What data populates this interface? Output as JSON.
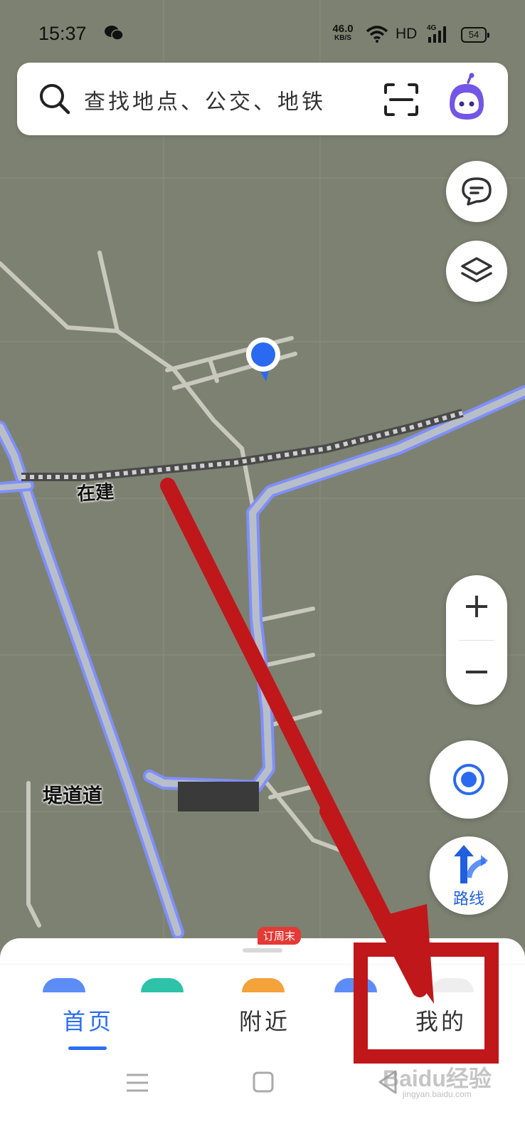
{
  "status_bar": {
    "time": "15:37",
    "speed_value": "46.0",
    "speed_unit": "KB/S",
    "hd": "HD",
    "network": "4G",
    "battery": "54",
    "icons": [
      "wechat-icon",
      "wifi-icon",
      "signal-icon",
      "battery-icon"
    ]
  },
  "search": {
    "placeholder": "查找地点、公交、地铁",
    "icons": [
      "search-icon",
      "scan-icon",
      "assistant-icon"
    ]
  },
  "map": {
    "labels": {
      "construction": "在建",
      "road": "堤道道"
    },
    "controls": {
      "zoom_in": "+",
      "zoom_out": "−",
      "route_label": "路线"
    },
    "icons": [
      "feedback-icon",
      "layers-icon",
      "location-icon",
      "route-icon",
      "location-marker-icon"
    ]
  },
  "bottom_sheet": {
    "badge": "订周末",
    "tabs": [
      {
        "label": "首页",
        "active": true
      },
      {
        "label": "附近",
        "active": false
      },
      {
        "label": "我的",
        "active": false
      }
    ]
  },
  "watermark": {
    "main": "Baidu经验",
    "sub": "jingyan.baidu.com"
  },
  "colors": {
    "accent": "#2b6ef5",
    "map_background": "#7d8171",
    "annotation": "#c0171a",
    "promo": "#e53935"
  }
}
